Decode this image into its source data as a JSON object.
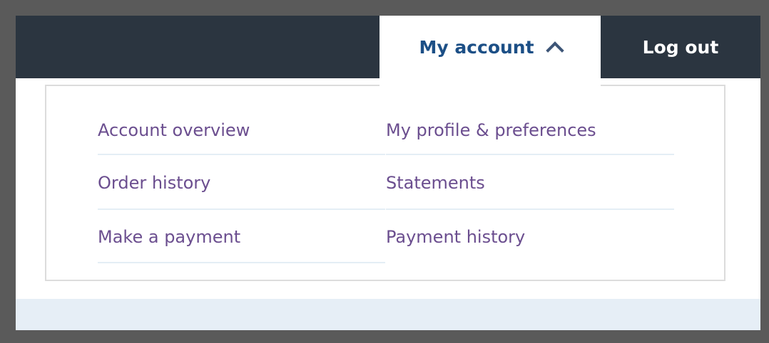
{
  "header": {
    "my_account_label": "My account",
    "log_out_label": "Log out"
  },
  "menu": {
    "left": [
      {
        "label": "Account overview"
      },
      {
        "label": "Order history"
      },
      {
        "label": "Make a payment"
      }
    ],
    "right": [
      {
        "label": "My profile & preferences"
      },
      {
        "label": "Statements"
      },
      {
        "label": "Payment history"
      }
    ]
  },
  "icons": {
    "my_account_toggle": "chevron-up-icon"
  },
  "colors": {
    "nav_background": "#2b3540",
    "active_tab_text": "#1c4f86",
    "menu_link": "#6b4e8f",
    "divider": "#e4eef5",
    "outer_frame": "#5a5a5a"
  }
}
